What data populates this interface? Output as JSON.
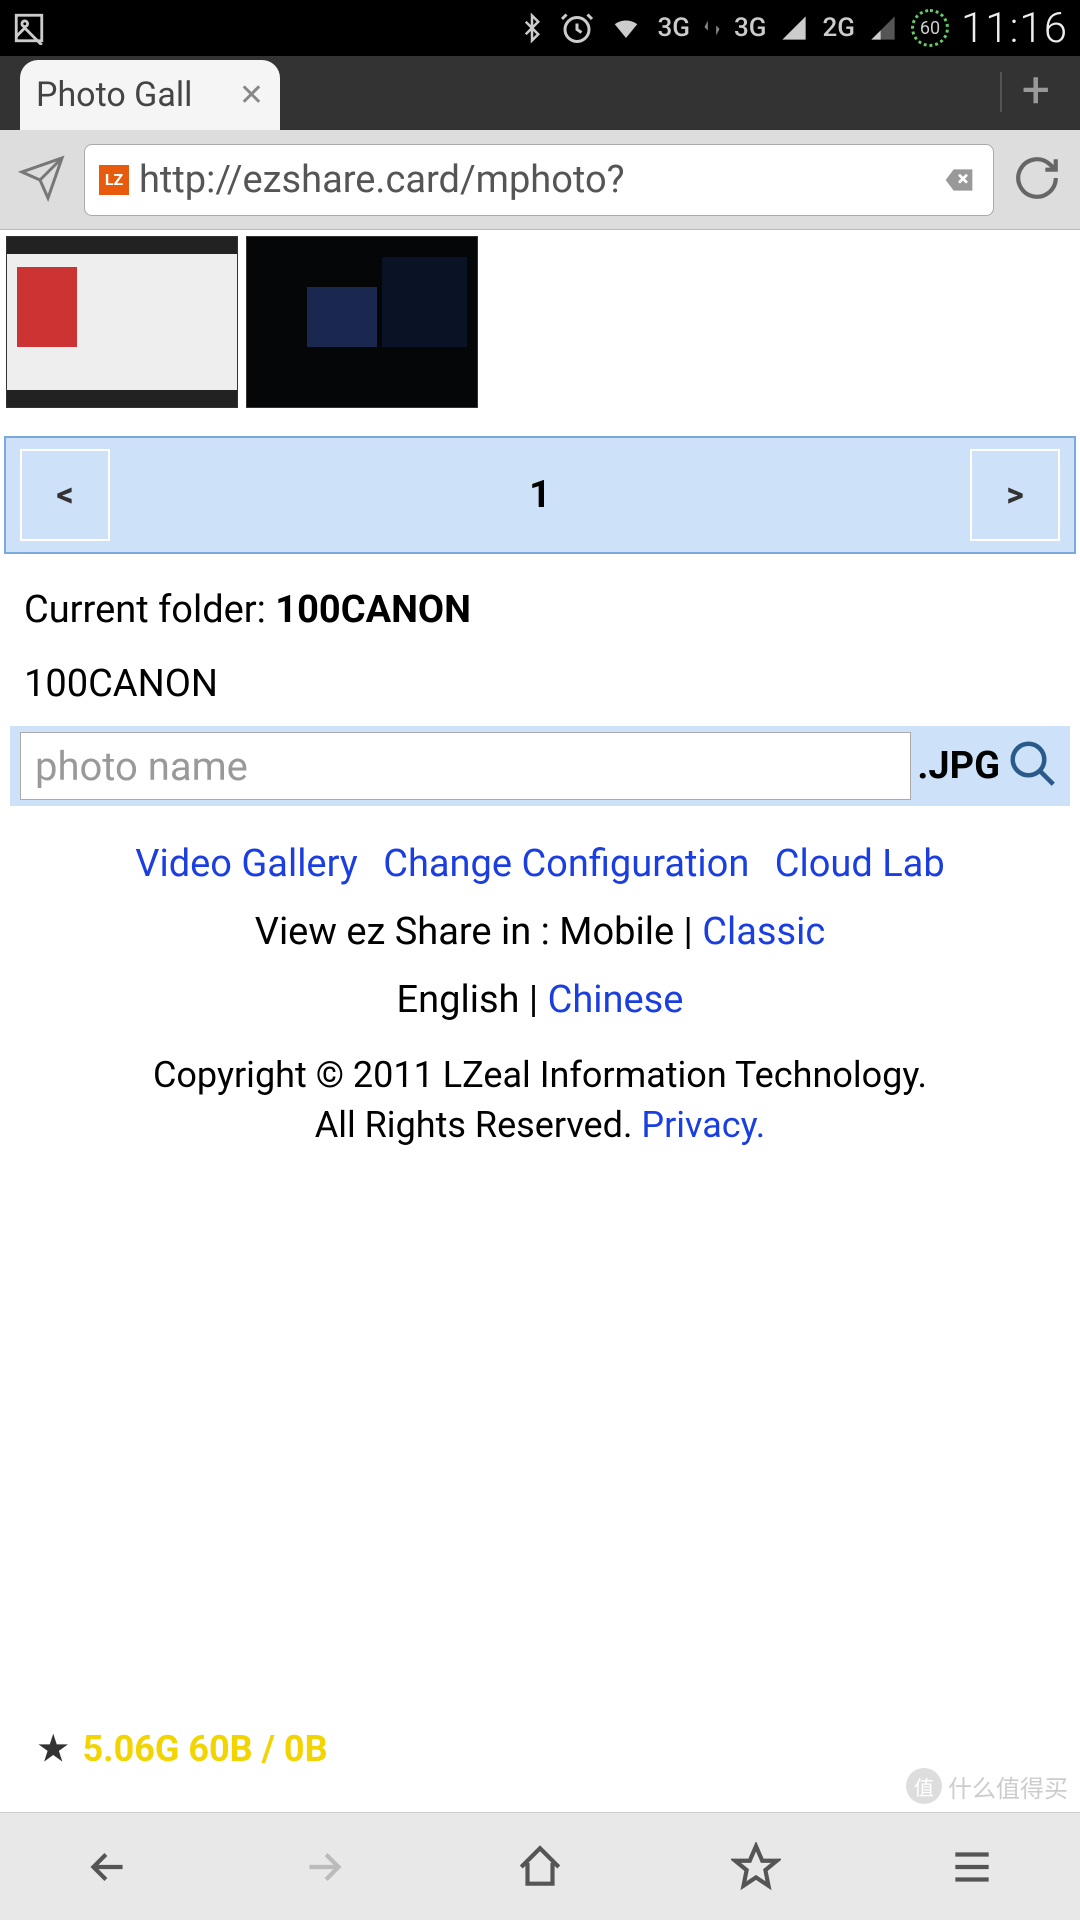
{
  "status": {
    "battery": "60",
    "clock": "11:16",
    "net1": "3G",
    "net2": "3G",
    "net3": "2G"
  },
  "tab": {
    "title": "Photo Gall"
  },
  "url": {
    "favicon": "LZ",
    "text": "http://ezshare.card/mphoto?"
  },
  "pager": {
    "prev": "<",
    "page": "1",
    "next": ">"
  },
  "folder": {
    "label": "Current folder: ",
    "name": "100CANON",
    "sub": "100CANON"
  },
  "search": {
    "placeholder": "photo name",
    "ext": ".JPG"
  },
  "links": {
    "video": "Video Gallery",
    "config": "Change Configuration",
    "cloud": "Cloud Lab"
  },
  "view": {
    "prefix": "View ez Share in : Mobile | ",
    "classic": "Classic"
  },
  "lang": {
    "en": "English",
    "sep": " | ",
    "zh": "Chinese"
  },
  "copy": {
    "line1": "Copyright © 2011 LZeal Information Technology.",
    "line2": "All Rights Reserved.  ",
    "privacy": "Privacy."
  },
  "stat": {
    "text": "5.06G  60B / 0B"
  },
  "watermark": {
    "icon": "值",
    "text": "什么值得买"
  }
}
